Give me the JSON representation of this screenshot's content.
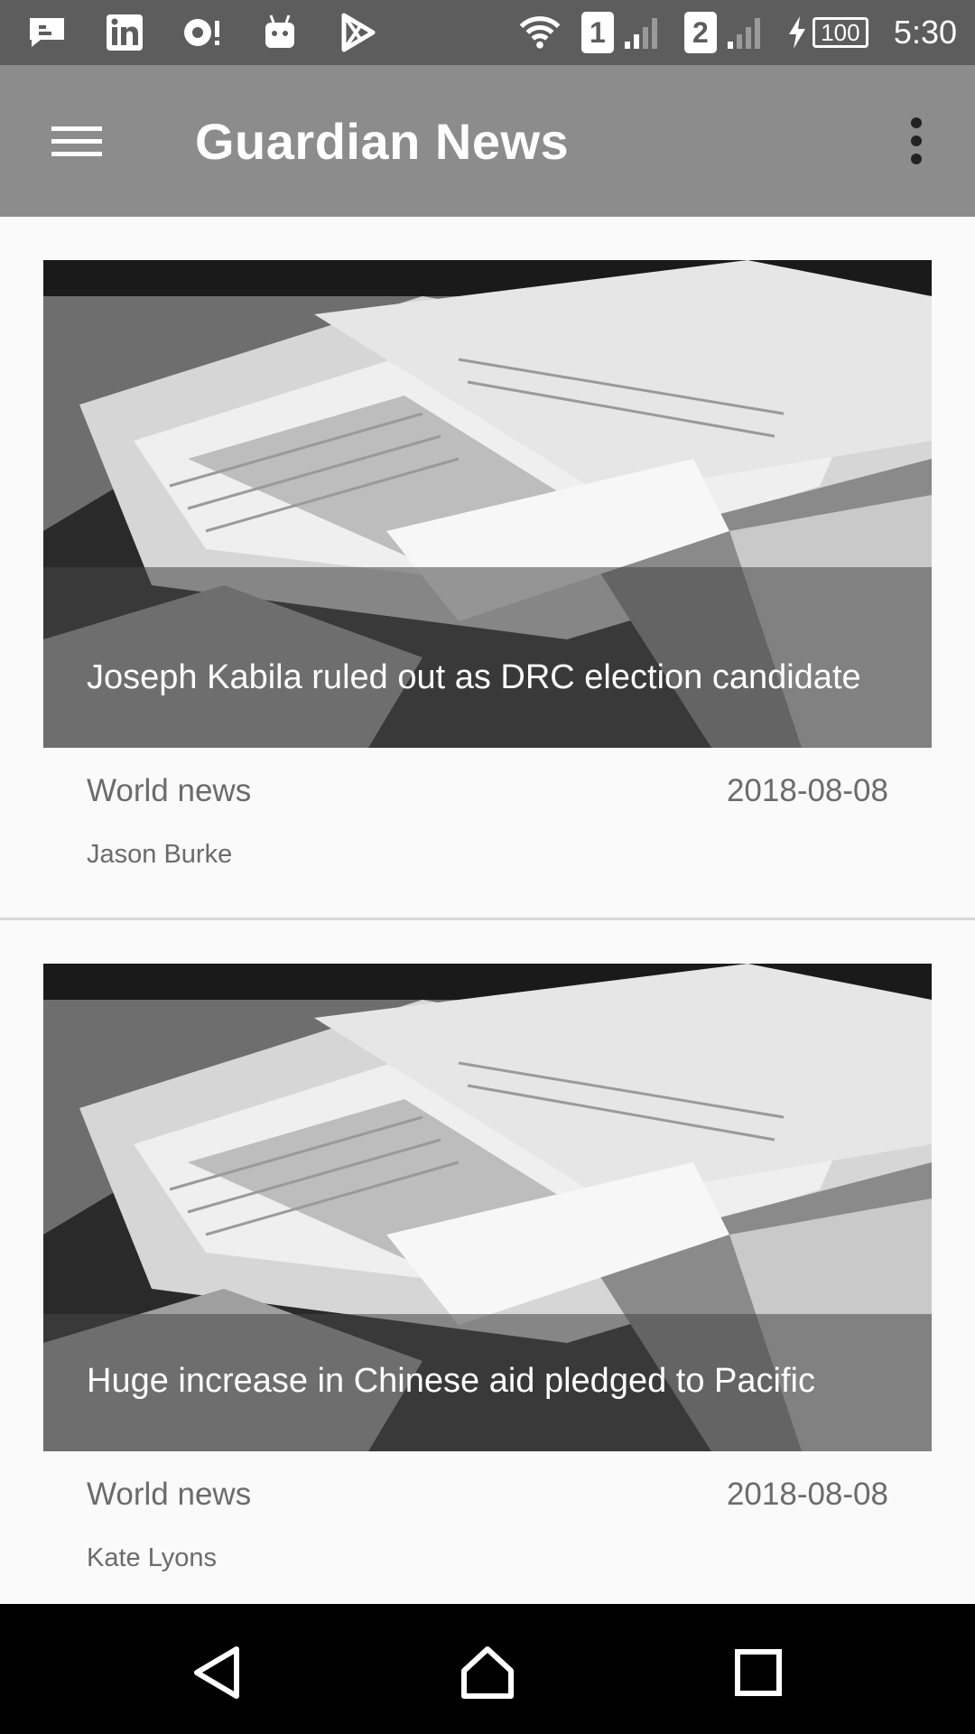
{
  "status_bar": {
    "time": "5:30",
    "battery": "100",
    "sim1": "1",
    "sim2": "2",
    "notification_icons": [
      "message-icon",
      "linkedin-icon",
      "record-icon",
      "android-icon",
      "play-store-icon"
    ]
  },
  "toolbar": {
    "title": "Guardian News"
  },
  "articles": [
    {
      "headline": "Joseph Kabila ruled out as DRC election candidate",
      "section": "World news",
      "date": "2018-08-08",
      "author": "Jason Burke"
    },
    {
      "headline": "Huge increase in Chinese aid pledged to Pacific",
      "section": "World news",
      "date": "2018-08-08",
      "author": "Kate Lyons"
    }
  ],
  "colors": {
    "status_bar": "#5d5d5d",
    "toolbar": "#8c8c8c",
    "background": "#fafafa",
    "nav_bar": "#000000"
  }
}
